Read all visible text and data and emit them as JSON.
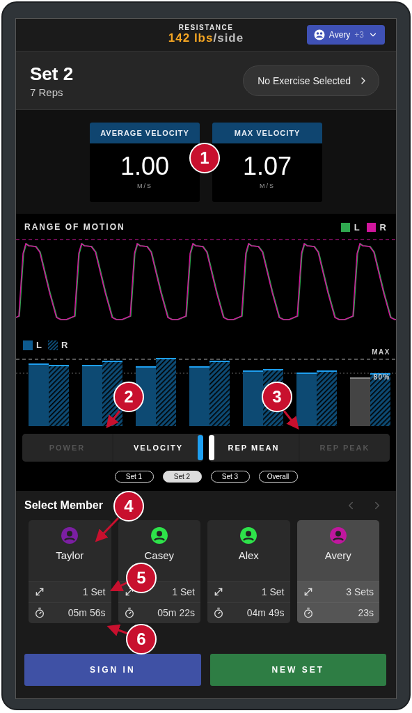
{
  "header": {
    "label": "RESISTANCE",
    "value": "142 lbs",
    "unit": "/side",
    "user_button": {
      "name": "Avery",
      "extra": "+3"
    }
  },
  "set": {
    "title": "Set 2",
    "reps": "7 Reps",
    "exercise_button": "No Exercise Selected"
  },
  "metrics": [
    {
      "label": "AVERAGE VELOCITY",
      "value": "1.00",
      "unit": "M/S"
    },
    {
      "label": "MAX VELOCITY",
      "value": "1.07",
      "unit": "M/S"
    }
  ],
  "range_of_motion": {
    "title": "RANGE OF MOTION",
    "legend": [
      {
        "label": "L",
        "color": "#2fa84f"
      },
      {
        "label": "R",
        "color": "#d0169c"
      }
    ]
  },
  "bar_chart": {
    "legend": [
      {
        "label": "L",
        "kind": "solid"
      },
      {
        "label": "R",
        "kind": "hatched"
      }
    ],
    "max_label": "MAX",
    "threshold_label": "80%"
  },
  "metric_toggle": [
    {
      "label": "POWER",
      "selected": false
    },
    {
      "label": "VELOCITY",
      "selected": true
    }
  ],
  "mode_toggle": [
    {
      "label": "REP MEAN",
      "selected": true
    },
    {
      "label": "REP PEAK",
      "selected": false
    }
  ],
  "set_tabs": [
    {
      "label": "Set 1",
      "selected": false
    },
    {
      "label": "Set 2",
      "selected": true
    },
    {
      "label": "Set 3",
      "selected": false
    },
    {
      "label": "Overall",
      "selected": false
    }
  ],
  "members": {
    "title": "Select Member",
    "items": [
      {
        "name": "Taylor",
        "color": "#7b1fa2",
        "sets": "1 Set",
        "time": "05m 56s",
        "selected": false
      },
      {
        "name": "Casey",
        "color": "#2ee24a",
        "sets": "1 Set",
        "time": "05m 22s",
        "selected": false
      },
      {
        "name": "Alex",
        "color": "#2ee24a",
        "sets": "1 Set",
        "time": "04m 49s",
        "selected": false
      },
      {
        "name": "Avery",
        "color": "#c0179e",
        "sets": "3 Sets",
        "time": "23s",
        "selected": true
      }
    ]
  },
  "actions": [
    {
      "label": "SIGN IN",
      "kind": "secondary"
    },
    {
      "label": "NEW SET",
      "kind": "primary"
    }
  ],
  "annotations": [
    {
      "label": "1"
    },
    {
      "label": "2"
    },
    {
      "label": "3"
    },
    {
      "label": "4"
    },
    {
      "label": "5"
    },
    {
      "label": "6"
    }
  ]
}
